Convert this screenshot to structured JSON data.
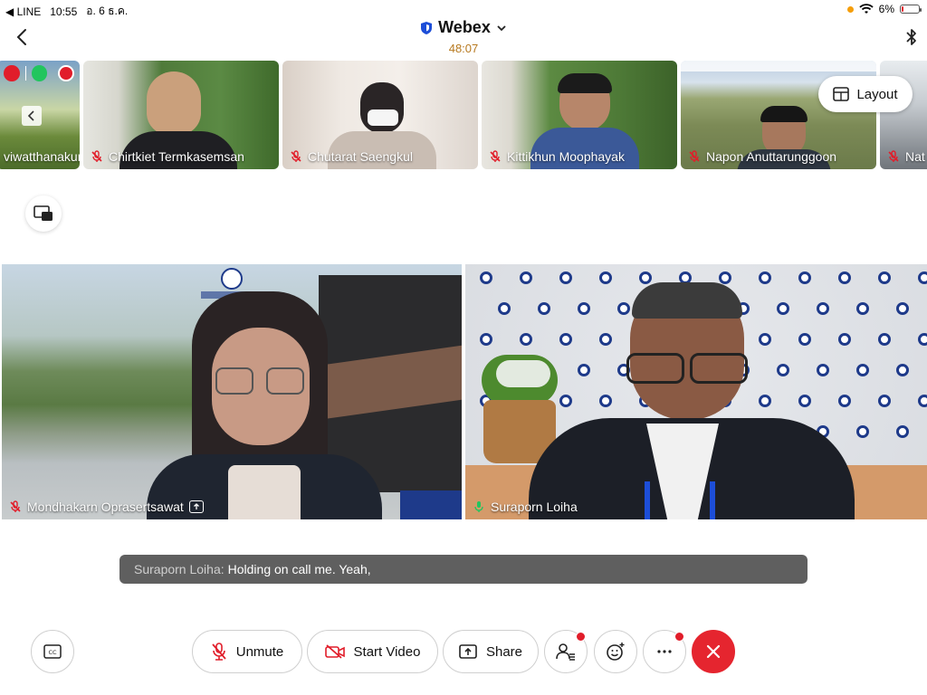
{
  "status_bar": {
    "back_app": "◀ LINE",
    "time": "10:55",
    "date": "อ. 6 ธ.ค.",
    "battery": "6%",
    "battery_level": 0.06
  },
  "header": {
    "title": "Webex",
    "timer": "48:07"
  },
  "thumbnails": [
    {
      "name": "viwatthanakun"
    },
    {
      "name": "Chirtkiet Termkasemsan"
    },
    {
      "name": "Chutarat Saengkul"
    },
    {
      "name": "Kittikhun Moophayak"
    },
    {
      "name": "Napon Anuttarunggoon"
    },
    {
      "name": "Nat"
    }
  ],
  "layout_button": {
    "label": "Layout"
  },
  "main_videos": [
    {
      "name": "Mondhakarn Oprasertsawat"
    },
    {
      "name": "Suraporn Loiha"
    }
  ],
  "caption": {
    "speaker": "Suraporn Loiha:",
    "text": "Holding on call me. Yeah,"
  },
  "controls": {
    "unmute": "Unmute",
    "start_video": "Start Video",
    "share": "Share"
  },
  "colors": {
    "accent_red": "#e5252f",
    "timer": "#b7791f",
    "caption_bg": "#5f5f5f"
  }
}
